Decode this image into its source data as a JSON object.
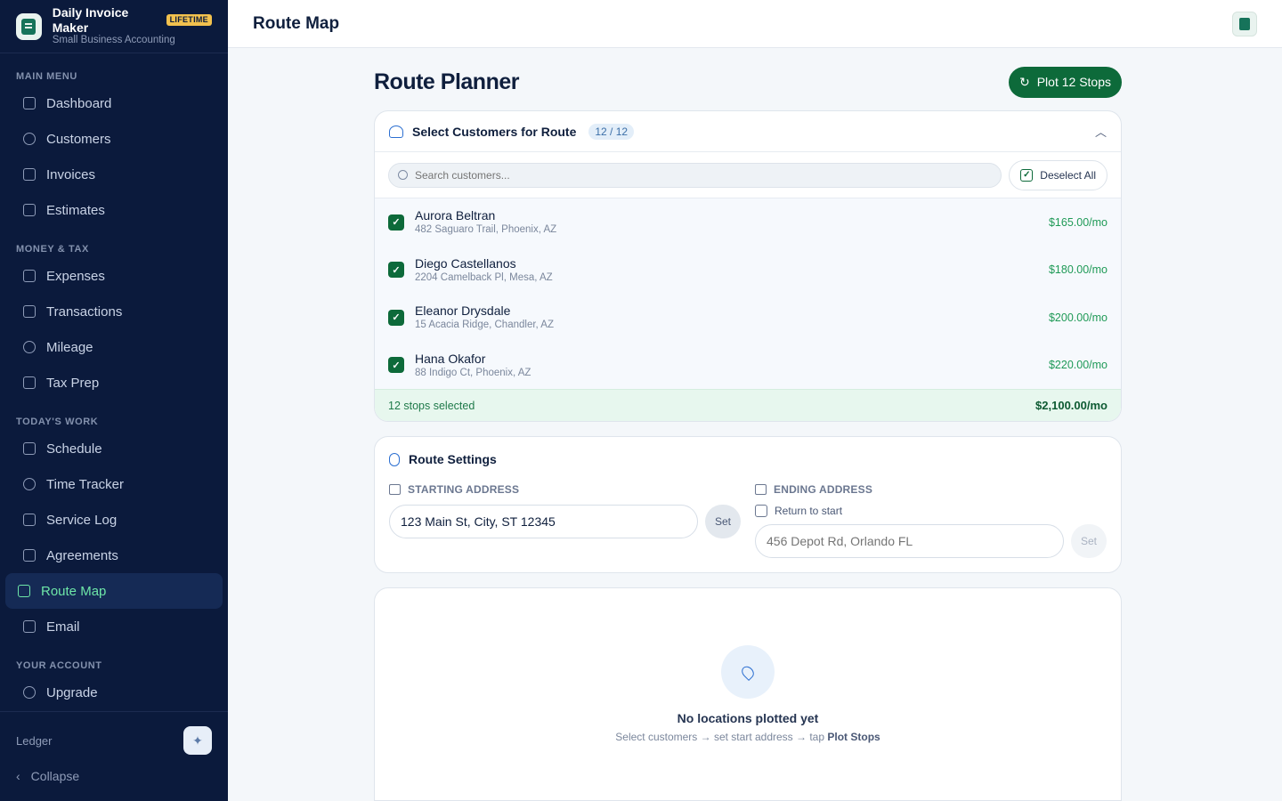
{
  "brand": {
    "title": "Daily Invoice Maker",
    "badge": "LIFETIME",
    "subtitle": "Small Business Accounting"
  },
  "sidebar": {
    "sections": [
      {
        "label": "MAIN MENU"
      },
      {
        "label": "MONEY & TAX"
      },
      {
        "label": "TODAY'S WORK"
      },
      {
        "label": "YOUR ACCOUNT"
      }
    ],
    "items": [
      {
        "label": "Dashboard",
        "icon": "grid-icon"
      },
      {
        "label": "Customers",
        "icon": "users-icon"
      },
      {
        "label": "Invoices",
        "icon": "file-icon"
      },
      {
        "label": "Estimates",
        "icon": "file-check-icon"
      },
      {
        "label": "Expenses",
        "icon": "receipt-icon"
      },
      {
        "label": "Transactions",
        "icon": "card-icon"
      },
      {
        "label": "Mileage",
        "icon": "location-icon"
      },
      {
        "label": "Tax Prep",
        "icon": "chart-icon"
      },
      {
        "label": "Schedule",
        "icon": "calendar-icon"
      },
      {
        "label": "Time Tracker",
        "icon": "clock-icon"
      },
      {
        "label": "Service Log",
        "icon": "list-icon"
      },
      {
        "label": "Agreements",
        "icon": "pen-icon"
      },
      {
        "label": "Route Map",
        "icon": "map-icon",
        "active": true
      },
      {
        "label": "Email",
        "icon": "mail-icon"
      },
      {
        "label": "Upgrade",
        "icon": "award-icon"
      }
    ],
    "footer_label": "Ledger",
    "collapse_label": "Collapse"
  },
  "topbar": {
    "title": "Route Map"
  },
  "planner": {
    "title": "Route Planner",
    "plot_button": "Plot 12 Stops"
  },
  "customers_card": {
    "title": "Select Customers for Route",
    "count": "12 / 12",
    "search_placeholder": "Search customers...",
    "deselect_label": "Deselect All",
    "rows": [
      {
        "name": "Aurora Beltran",
        "address": "482 Saguaro Trail, Phoenix, AZ",
        "price": "$165.00/mo"
      },
      {
        "name": "Diego Castellanos",
        "address": "2204 Camelback Pl, Mesa, AZ",
        "price": "$180.00/mo"
      },
      {
        "name": "Eleanor Drysdale",
        "address": "15 Acacia Ridge, Chandler, AZ",
        "price": "$200.00/mo"
      },
      {
        "name": "Hana Okafor",
        "address": "88 Indigo Ct, Phoenix, AZ",
        "price": "$220.00/mo"
      }
    ],
    "selected_text": "12 stops selected",
    "selected_total": "$2,100.00/mo"
  },
  "settings": {
    "title": "Route Settings",
    "start_label": "STARTING ADDRESS",
    "start_value": "123 Main St, City, ST 12345",
    "end_label": "ENDING ADDRESS",
    "return_label": "Return to start",
    "end_placeholder": "456 Depot Rd, Orlando FL",
    "set_label": "Set"
  },
  "map": {
    "empty_title": "No locations plotted yet",
    "empty_sub_prefix": "Select customers → set start address → tap",
    "empty_sub_action": "Plot Stops"
  }
}
